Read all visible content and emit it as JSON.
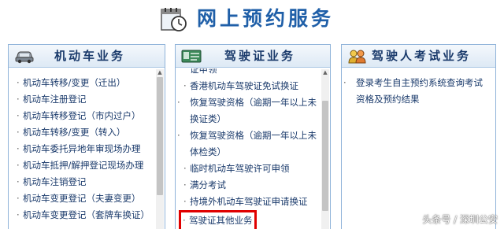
{
  "header": {
    "title": "网上预约服务",
    "icon": "calendar-clock-icon"
  },
  "panels": {
    "vehicle": {
      "title": "机动车业务",
      "icon": "car-icon",
      "items": [
        "机动车转移/变更（迁出）",
        "机动车注册登记",
        "机动车转移登记（市内过户）",
        "机动车转移/变更（转入）",
        "机动车委托异地年审现场办理",
        "机动车抵押/解押登记现场办理",
        "机动车注销登记",
        "机动车变更登记（夫妻变更）",
        "机动车变更登记（套牌车换证）"
      ]
    },
    "license": {
      "title": "驾驶证业务",
      "icon": "id-card-icon",
      "partial_top": "证申领",
      "items": [
        "香港机动车驾驶证免试换证",
        "恢复驾驶资格（逾期一年以上未换证类）",
        "恢复驾驶资格（逾期一年以上未体检类）",
        "临时机动车驾驶许可申领",
        "满分考试",
        "持境外机动车驾驶证申请换证",
        "驾驶证其他业务"
      ]
    },
    "exam": {
      "title": "驾驶人考试业务",
      "icon": "users-icon",
      "items": [
        "登录考生自主预约系统查询考试资格及预约结果"
      ]
    }
  },
  "watermark": "头条号 / 深圳公安"
}
